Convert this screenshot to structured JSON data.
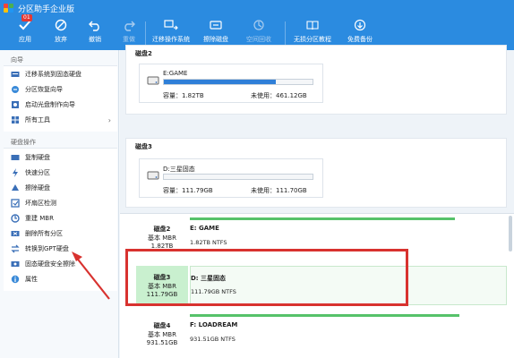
{
  "titlebar": {
    "title": "分区助手企业版"
  },
  "toolbar": {
    "badge": "01",
    "items": [
      {
        "label": "应用",
        "icon": "check-icon",
        "enabled": true
      },
      {
        "label": "放弃",
        "icon": "discard-icon",
        "enabled": true
      },
      {
        "label": "撤销",
        "icon": "undo-icon",
        "enabled": true
      },
      {
        "label": "重做",
        "icon": "redo-icon",
        "enabled": false
      },
      {
        "label": "迁移操作系统",
        "icon": "migrate-os-icon",
        "enabled": true
      },
      {
        "label": "擦除磁盘",
        "icon": "wipe-disk-icon",
        "enabled": true
      },
      {
        "label": "空间回收",
        "icon": "space-recycle-icon",
        "enabled": false
      },
      {
        "label": "无损分区教程",
        "icon": "tutorial-icon",
        "enabled": true
      },
      {
        "label": "免费备份",
        "icon": "backup-icon",
        "enabled": true
      }
    ]
  },
  "sidebar": {
    "wizard_title": "向导",
    "wizard_items": [
      {
        "label": "迁移系统到固态硬盘",
        "icon": "migrate-icon"
      },
      {
        "label": "分区恢复向导",
        "icon": "recover-icon"
      },
      {
        "label": "启动光盘制作向导",
        "icon": "bootdisk-icon"
      },
      {
        "label": "所有工具",
        "icon": "tools-icon",
        "chevron": "›"
      }
    ],
    "disk_ops_title": "硬盘操作",
    "disk_ops_items": [
      {
        "label": "复制硬盘",
        "icon": "copy-disk-icon"
      },
      {
        "label": "快速分区",
        "icon": "quick-partition-icon"
      },
      {
        "label": "擦除硬盘",
        "icon": "wipe-icon"
      },
      {
        "label": "坏扇区检测",
        "icon": "bad-sector-icon"
      },
      {
        "label": "重建 MBR",
        "icon": "rebuild-mbr-icon"
      },
      {
        "label": "删除所有分区",
        "icon": "delete-all-icon"
      },
      {
        "label": "转换到GPT硬盘",
        "icon": "convert-gpt-icon"
      },
      {
        "label": "固态硬盘安全擦除",
        "icon": "ssd-erase-icon"
      },
      {
        "label": "属性",
        "icon": "properties-icon"
      }
    ]
  },
  "disks_view": {
    "disk2": {
      "label": "磁盘2",
      "partition_name": "E:GAME",
      "capacity": "容量：1.82TB",
      "free": "未使用：461.12GB",
      "used_fraction": 0.75
    },
    "disk3": {
      "label": "磁盘3",
      "partition_name": "D:三星固态",
      "capacity": "容量：111.79GB",
      "free": "未使用：111.70GB",
      "used_fraction": 0.0
    }
  },
  "disk_table": {
    "rows": [
      {
        "disk": "磁盘2",
        "type": "基本 MBR",
        "size": "1.82TB",
        "partition": "E: GAME",
        "info": "1.82TB NTFS",
        "fill": 0.0,
        "selected": false
      },
      {
        "disk": "磁盘3",
        "type": "基本 MBR",
        "size": "111.79GB",
        "partition": "D: 三星固态",
        "info": "111.79GB NTFS",
        "fill": 0.0,
        "selected": true
      },
      {
        "disk": "磁盘4",
        "type": "基本 MBR",
        "size": "931.51GB",
        "partition": "F: LOADREAM",
        "info": "931.51GB NTFS",
        "fill": 0.85,
        "selected": false
      }
    ]
  },
  "colors": {
    "accent": "#2b8be0",
    "bar_blue": "#2f7fd8",
    "bar_green": "#56c26a",
    "highlight_red": "#d8322f"
  }
}
